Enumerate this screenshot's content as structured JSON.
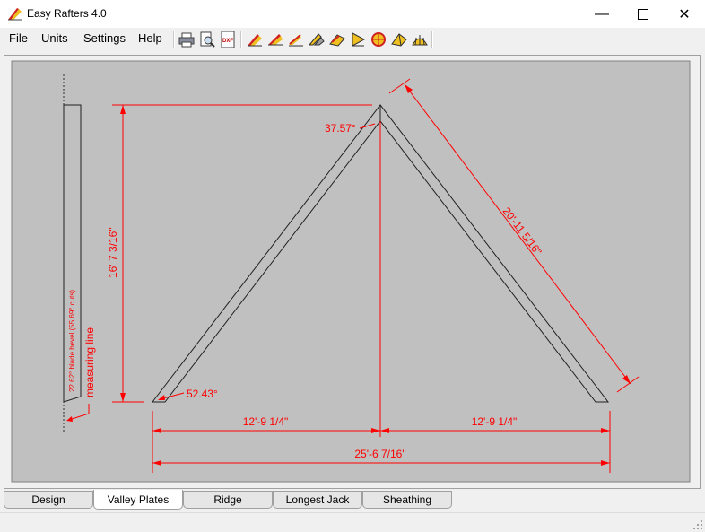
{
  "window": {
    "title": "Easy Rafters 4.0"
  },
  "menu": [
    "File",
    "Units",
    "Settings",
    "Help"
  ],
  "toolbar": {
    "tools": [
      "print-icon",
      "print-preview-icon",
      "dxf-export-icon",
      "common-rafter-icon",
      "hip-rafter-icon",
      "valley-rafter-icon",
      "jack-rafter-icon",
      "ridge-icon",
      "gable-icon",
      "octagon-icon",
      "cone-icon",
      "dome-icon"
    ]
  },
  "drawing": {
    "plate_annotation": "22.62° blade bevel (55.69° cuts)",
    "measuring_line_label": "measuring line",
    "height_dim": "16' 7 3/16\"",
    "peak_angle": "37.57°",
    "base_angle": "52.43°",
    "slope_dim": "20'-11 5/16\"",
    "left_half_dim": "12'-9 1/4\"",
    "right_half_dim": "12'-9 1/4\"",
    "total_dim": "25'-6 7/16\"",
    "dim_color": "#ff0000",
    "canvas_color": "#c0c0c0"
  },
  "tabs": [
    {
      "label": "Design",
      "active": false
    },
    {
      "label": "Valley Plates",
      "active": true
    },
    {
      "label": "Ridge",
      "active": false
    },
    {
      "label": "Longest Jack",
      "active": false
    },
    {
      "label": "Sheathing",
      "active": false
    }
  ]
}
